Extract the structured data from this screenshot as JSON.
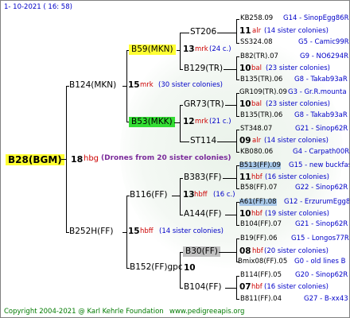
{
  "header": {
    "date": "1-  10-2021  ( 16:  58)"
  },
  "root": {
    "name": "B28(BGM)",
    "gen_num": "18",
    "gen_code": "hbg",
    "colony_text": "(Drones from 20 sister colonies)"
  },
  "gen1": [
    {
      "name": "B124(MKN)",
      "num": "15",
      "code": "mrk",
      "colony_text": "(30 sister colonies)"
    },
    {
      "name": "B252H(FF)",
      "num": "15",
      "code": "hbff",
      "colony_text": "(14 sister colonies)"
    }
  ],
  "gen2": [
    {
      "name": "B59(MKN)",
      "num": "13",
      "code": "mrk",
      "colony_text": "(24 c.)"
    },
    {
      "name": "B53(MKK)",
      "num": "12",
      "code": "mrk",
      "colony_text": "(21 c.)"
    },
    {
      "name": "B116(FF)",
      "num": "13",
      "code": "hbff",
      "colony_text": "(16 c.)"
    },
    {
      "name": "B152(FF)gpc",
      "num": "10",
      "code": "",
      "colony_text": ""
    }
  ],
  "gen3": [
    {
      "name": "ST206",
      "num": "11",
      "code": "alr",
      "colony_text": "(14 sister colonies)"
    },
    {
      "name": "B129(TR)",
      "num": "10",
      "code": "bal",
      "colony_text": "(23 sister colonies)"
    },
    {
      "name": "GR73(TR)",
      "num": "10",
      "code": "bal",
      "colony_text": "(23 sister colonies)"
    },
    {
      "name": "ST114",
      "num": "09",
      "code": "alr",
      "colony_text": "(14 sister colonies)"
    },
    {
      "name": "B383(FF)",
      "num": "11",
      "code": "hbf",
      "colony_text": "(16 sister colonies)"
    },
    {
      "name": "A144(FF)",
      "num": "10",
      "code": "hbf",
      "colony_text": "(19 sister colonies)"
    },
    {
      "name": "B30(FF)",
      "num": "08",
      "code": "hbf",
      "colony_text": "(20 sister colonies)"
    },
    {
      "name": "B104(FF)",
      "num": "07",
      "code": "hbf",
      "colony_text": "(16 sister colonies)"
    }
  ],
  "gen4": [
    {
      "name": "KB258.09",
      "info": "G14 - SinopEgg86R"
    },
    {
      "name": "SS324.08",
      "info": "G5 - Camic99R"
    },
    {
      "name": "B82(TR).07",
      "info": "G9 - NO6294R"
    },
    {
      "name": "B135(TR).06",
      "info": "G8 - Takab93aR"
    },
    {
      "name": "GR109(TR).09",
      "info": "G3 - Gr.R.mounta"
    },
    {
      "name": "B135(TR).06",
      "info": "G8 - Takab93aR"
    },
    {
      "name": "ST348.07",
      "info": "G21 - Sinop62R"
    },
    {
      "name": "KB080.06",
      "info": "G4 - Carpath00R"
    },
    {
      "name": "B513(FF).09",
      "info": "G15 - new buckfas"
    },
    {
      "name": "B58(FF).07",
      "info": "G22 - Sinop62R"
    },
    {
      "name": "A61(FF).08",
      "info": "G12 - ErzurumEgg8"
    },
    {
      "name": "B104(FF).07",
      "info": "G21 - Sinop62R"
    },
    {
      "name": "B19(FF).06",
      "info": "G15 - Longos77R"
    },
    {
      "name": "Bmix08(FF).05",
      "info": "G0 - old lines B"
    },
    {
      "name": "B114(FF).05",
      "info": "G20 - Sinop62R"
    },
    {
      "name": "B811(FF).04",
      "info": "G27 - B-xx43"
    }
  ],
  "footer": {
    "copyright": "Copyright 2004-2021 @ Karl Kehrle Foundation",
    "website": "www.pedigreeapis.org"
  },
  "colors": {
    "yellow": "#ffff33",
    "green": "#33dd33",
    "gray": "#c0c0c0",
    "red": "#cc0000",
    "blue": "#0000c8"
  }
}
